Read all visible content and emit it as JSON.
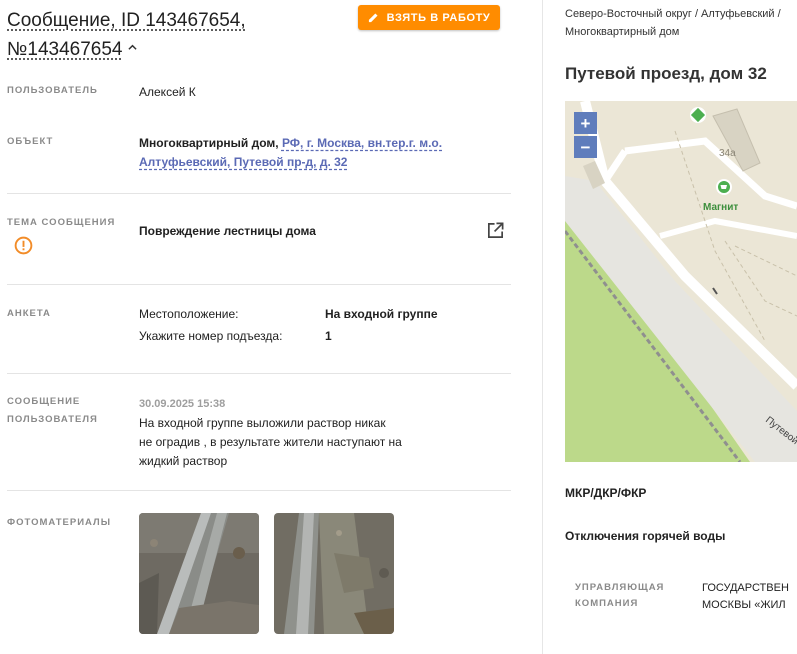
{
  "header": {
    "title_line1": "Сообщение, ID 143467654,",
    "title_line2": "№143467654",
    "take_button_label": "ВЗЯТЬ В РАБОТУ"
  },
  "user": {
    "label": "ПОЛЬЗОВАТЕЛЬ",
    "value": "Алексей К"
  },
  "object": {
    "label": "ОБЪЕКТ",
    "type": "Многоквартирный дом,",
    "address_line1": "РФ, г. Москва, вн.тер.г. м.о.",
    "address_line2": "Алтуфьевский, Путевой пр-д, д. 32"
  },
  "topic": {
    "label": "ТЕМА СООБЩЕНИЯ",
    "value": "Повреждение лестницы дома"
  },
  "survey": {
    "label": "АНКЕТА",
    "rows": [
      {
        "question": "Местоположение:",
        "answer": "На входной группе"
      },
      {
        "question": "Укажите номер подъезда:",
        "answer": "1"
      }
    ]
  },
  "message": {
    "label_line1": "СООБЩЕНИЕ",
    "label_line2": "ПОЛЬЗОВАТЕЛЯ",
    "date": "30.09.2025 15:38",
    "text_line1": "На входной группе выложили раствор никак",
    "text_line2": "не оградив , в результате жители наступают на",
    "text_line3": "жидкий раствор"
  },
  "photos": {
    "label": "ФОТОМАТЕРИАЛЫ",
    "count": 2
  },
  "right": {
    "breadcrumb_line1": "Северо-Восточный округ / Алтуфьевский /",
    "breadcrumb_line2": "Многоквартирный дом",
    "address": "Путевой проезд, дом 32",
    "map": {
      "zoom_in": "+",
      "zoom_out": "−",
      "building_number": "34а",
      "shop_label": "Магнит",
      "street_label": "Путевой"
    },
    "mkr_label": "МКР/ДКР/ФКР",
    "hot_water_label": "Отключения горячей воды",
    "uk_label_line1": "УПРАВЛЯЮЩАЯ",
    "uk_label_line2": "КОМПАНИЯ",
    "uk_value_line1": "ГОСУДАРСТВЕН",
    "uk_value_line2": "МОСКВЫ «ЖИЛ"
  },
  "colors": {
    "accent": "#ff8c00",
    "link": "#5b6ab5",
    "warning": "#f28c28",
    "map_zoom": "#5f7dbc",
    "map_green": "#bcd98a"
  },
  "icons": {
    "pencil": "pencil-icon",
    "chevron": "chevron-up-icon",
    "warning": "warning-circle-icon",
    "external": "open-external-icon",
    "shop": "cart-icon"
  }
}
